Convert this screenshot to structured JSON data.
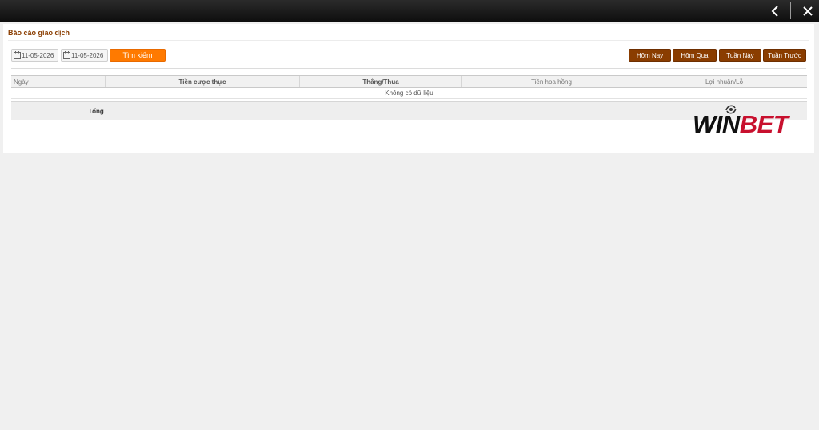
{
  "topbar": {
    "back_icon": "chevron-left-icon",
    "close_icon": "close-icon"
  },
  "report": {
    "title": "Báo cáo giao dịch",
    "date_from": "11-05-2026",
    "date_to": "11-05-2026",
    "search_label": "Tìm kiếm",
    "quick_filters": [
      "Hôm Nay",
      "Hôm Qua",
      "Tuần Này",
      "Tuần Trước"
    ],
    "columns": [
      "Ngày",
      "Tiền cược thực",
      "Thắng/Thua",
      "Tiền hoa hồng",
      "Lợi nhuận/Lỗ"
    ],
    "empty_message": "Không có dữ liệu",
    "total_label": "Tổng"
  },
  "brand": {
    "logo_text_1": "WIN",
    "logo_text_2": "BET",
    "accent_color": "#ff7a00",
    "primary_color": "#8a3d00",
    "logo_red": "#c8102e"
  }
}
